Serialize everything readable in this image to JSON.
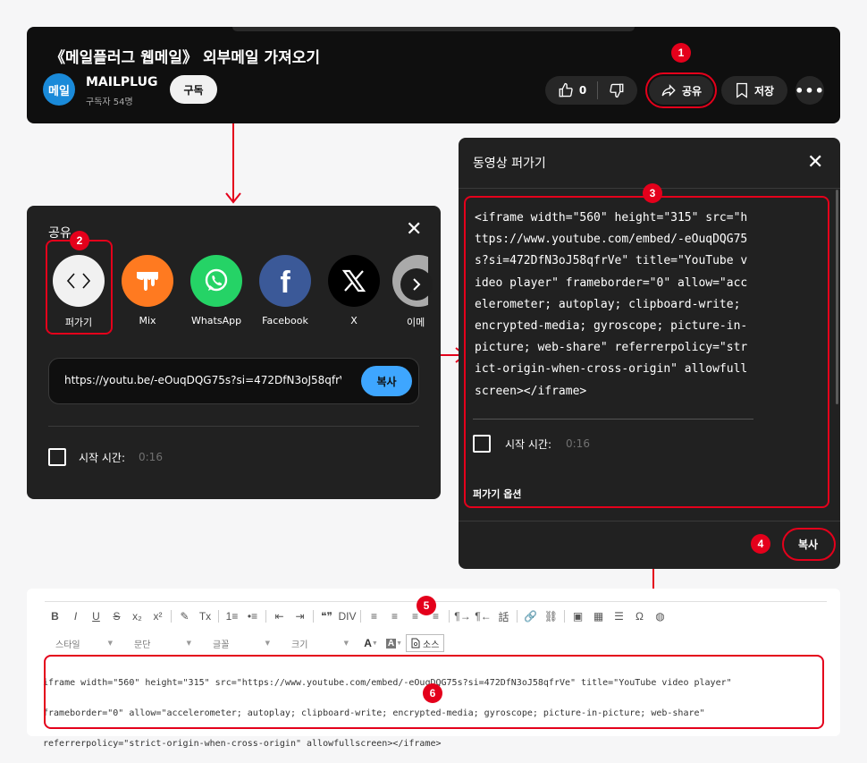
{
  "video": {
    "title": "《메일플러그 웹메일》 외부메일 가져오기",
    "avatar_text": "메일",
    "channel": "MAILPLUG",
    "subscribers": "구독자 54명",
    "subscribe_label": "구독",
    "likes": "0",
    "share_label": "공유",
    "save_label": "저장"
  },
  "share_panel": {
    "title": "공유",
    "items": [
      {
        "label": "퍼가기",
        "icon": "embed-code-icon"
      },
      {
        "label": "Mix",
        "icon": "mix-icon"
      },
      {
        "label": "WhatsApp",
        "icon": "whatsapp-icon"
      },
      {
        "label": "Facebook",
        "icon": "facebook-icon"
      },
      {
        "label": "X",
        "icon": "x-icon"
      },
      {
        "label": "이메"
      }
    ],
    "url": "https://youtu.be/-eOuqDQG75s?si=472DfN3oJ58qfrV",
    "copy_label": "복사",
    "start_time_label": "시작 시간:",
    "start_time_value": "0:16"
  },
  "embed_panel": {
    "title": "동영상 퍼가기",
    "code": "<iframe width=\"560\" height=\"315\" src=\"https://www.youtube.com/embed/-eOuqDQG75s?si=472DfN3oJ58qfrVe\" title=\"YouTube video player\" frameborder=\"0\" allow=\"accelerometer; autoplay; clipboard-write; encrypted-media; gyroscope; picture-in-picture; web-share\" referrerpolicy=\"strict-origin-when-cross-origin\" allowfullscreen></iframe>",
    "start_time_label": "시작 시간:",
    "start_time_value": "0:16",
    "options_label": "퍼가기 옵션",
    "copy_label": "복사"
  },
  "editor": {
    "toolbar": [
      "B",
      "I",
      "U",
      "S",
      "x₂",
      "x²",
      "✎",
      "Tx",
      "1≡",
      "•≡",
      "⇤",
      "⇥",
      "❝❞",
      "DIV",
      "≡",
      "≡",
      "≡",
      "≡",
      "¶→",
      "¶←",
      "話",
      "🔗",
      "⛓",
      "▣",
      "▦",
      "☰",
      "Ω",
      "◍"
    ],
    "combos": [
      {
        "label": "스타일"
      },
      {
        "label": "문단"
      },
      {
        "label": "글꼴"
      },
      {
        "label": "크기"
      }
    ],
    "source_label": "소스",
    "content_line1": "iframe width=\"560\" height=\"315\" src=\"https://www.youtube.com/embed/-eOuqDQG75s?si=472DfN3oJ58qfrVe\" title=\"YouTube video player\"",
    "content_line2": "frameborder=\"0\" allow=\"accelerometer; autoplay; clipboard-write; encrypted-media; gyroscope; picture-in-picture; web-share\"",
    "content_line3": "referrerpolicy=\"strict-origin-when-cross-origin\" allowfullscreen></iframe>"
  },
  "badges": [
    "1",
    "2",
    "3",
    "4",
    "5",
    "6"
  ],
  "colors": {
    "highlight": "#e4001b",
    "dark_bg": "#0f0f0f",
    "panel_bg": "#212121",
    "copy_blue": "#3ea6ff"
  }
}
